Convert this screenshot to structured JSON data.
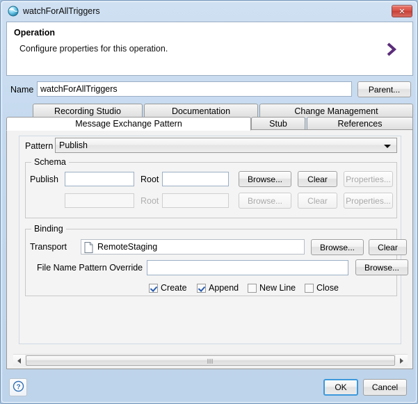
{
  "window": {
    "title": "watchForAllTriggers",
    "icon": "globe-icon",
    "close_label": "✕",
    "accent_purple": "#5b2d7a",
    "close_red": "#c63f36",
    "focus_blue": "#3c99dc"
  },
  "banner": {
    "title": "Operation",
    "description": "Configure properties for this operation.",
    "chevron": "chevron-right-icon"
  },
  "name_row": {
    "label": "Name",
    "value": "watchForAllTriggers",
    "placeholder": "",
    "parent_button": "Parent..."
  },
  "tabs": {
    "row1": [
      {
        "label": "Recording Studio",
        "selected": false
      },
      {
        "label": "Documentation",
        "selected": false
      },
      {
        "label": "Change Management",
        "selected": false
      }
    ],
    "row2": [
      {
        "label": "Message Exchange Pattern",
        "selected": true
      },
      {
        "label": "Stub",
        "selected": false
      },
      {
        "label": "References",
        "selected": false
      }
    ]
  },
  "pattern": {
    "label": "Pattern",
    "value": "Publish",
    "options": [
      "Publish"
    ]
  },
  "schema": {
    "group_title": "Schema",
    "rows": [
      {
        "label": "Publish",
        "schema_value": "",
        "root_label": "Root",
        "root_value": "",
        "browse": "Browse...",
        "clear": "Clear",
        "properties": "Properties...",
        "browse_enabled": true,
        "clear_enabled": true,
        "properties_enabled": false,
        "fields_enabled": true
      },
      {
        "label": "",
        "schema_value": "",
        "root_label": "Root",
        "root_value": "",
        "browse": "Browse...",
        "clear": "Clear",
        "properties": "Properties...",
        "browse_enabled": false,
        "clear_enabled": false,
        "properties_enabled": false,
        "fields_enabled": false
      }
    ]
  },
  "binding": {
    "group_title": "Binding",
    "transport_label": "Transport",
    "transport_value": "RemoteStaging",
    "transport_icon": "document-icon",
    "transport_browse": "Browse...",
    "transport_clear": "Clear",
    "filename_label": "File Name Pattern Override",
    "filename_value": "",
    "filename_placeholder": "",
    "filename_browse": "Browse...",
    "checkboxes": [
      {
        "label": "Create",
        "checked": true
      },
      {
        "label": "Append",
        "checked": true
      },
      {
        "label": "New Line",
        "checked": false
      },
      {
        "label": "Close",
        "checked": false
      }
    ]
  },
  "scrollbar": {
    "left_arrow": "scroll-left-icon",
    "right_arrow": "scroll-right-icon",
    "grip": "scroll-grip-icon"
  },
  "footer": {
    "help": "?",
    "ok": "OK",
    "cancel": "Cancel"
  }
}
